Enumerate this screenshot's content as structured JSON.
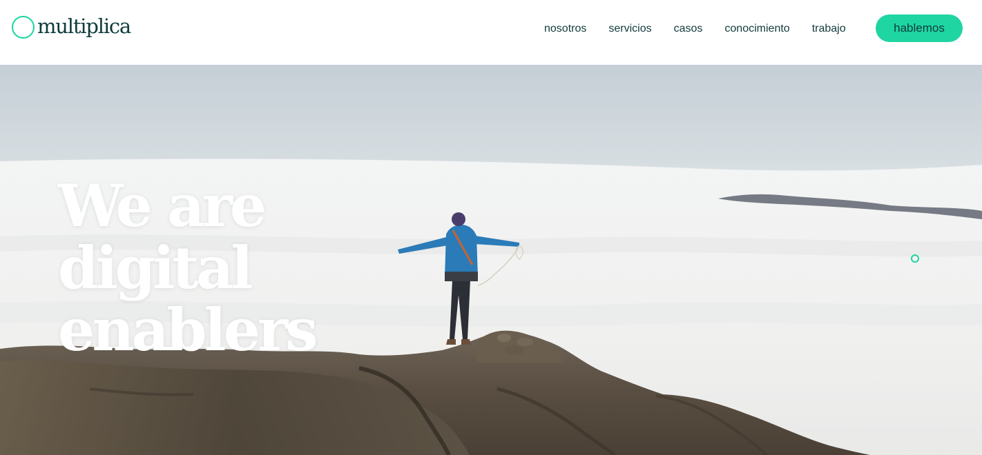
{
  "brand": {
    "logo_text": "multiplica",
    "logo_icon": "ring-icon",
    "accent_color": "#1fd5a2",
    "text_color": "#0f3b3c"
  },
  "nav": {
    "items": [
      {
        "label": "nosotros"
      },
      {
        "label": "servicios"
      },
      {
        "label": "casos"
      },
      {
        "label": "conocimiento"
      },
      {
        "label": "trabajo"
      }
    ],
    "cta_label": "hablemos"
  },
  "hero": {
    "headline_lines": [
      "We are",
      "digital",
      "enablers"
    ],
    "headline_color": "#ffffff",
    "slide_indicator_icon": "circle-outline-icon"
  }
}
